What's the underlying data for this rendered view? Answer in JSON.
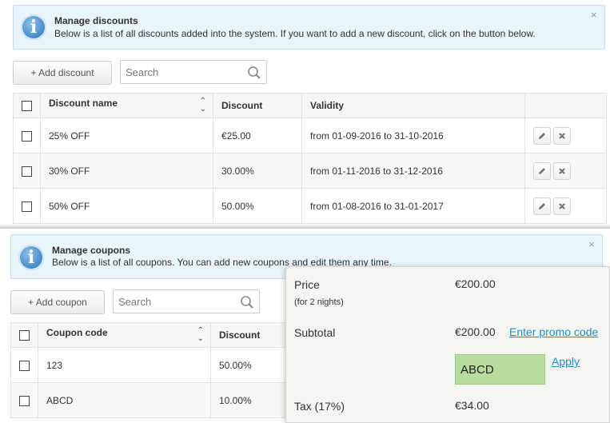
{
  "discounts_panel": {
    "info": {
      "title": "Manage discounts",
      "text": "Below is a list of all discounts added into the system. If you want to add a new discount, click on the button below.",
      "close": "×"
    },
    "add_button": "+ Add discount",
    "search_placeholder": "Search",
    "columns": [
      "Discount name",
      "Discount",
      "Validity"
    ],
    "rows": [
      {
        "name": "25% OFF",
        "discount": "€25.00",
        "validity": "from 01-09-2016 to 31-10-2016"
      },
      {
        "name": "30% OFF",
        "discount": "30.00%",
        "validity": "from 01-11-2016 to 31-12-2016"
      },
      {
        "name": "50% OFF",
        "discount": "50.00%",
        "validity": "from 01-08-2016 to 31-01-2017"
      }
    ],
    "row_actions": [
      "pencil-icon",
      "close-icon"
    ]
  },
  "coupons_panel": {
    "info": {
      "title": "Manage coupons",
      "text": "Below is a list of all coupons. You can add new coupons and edit them any time.",
      "close": "×"
    },
    "add_button": "+ Add coupon",
    "search_placeholder": "Search",
    "columns": [
      "Coupon code",
      "Discount"
    ],
    "rows": [
      {
        "code": "123",
        "discount": "50.00%"
      },
      {
        "code": "ABCD",
        "discount": "10.00%"
      }
    ]
  },
  "price_summary": {
    "price_label": "Price",
    "price_value": "€200.00",
    "nights_note": "(for 2 nights)",
    "subtotal_label": "Subtotal",
    "subtotal_value": "€200.00",
    "promo_link": "Enter promo code",
    "promo_value": "ABCD",
    "apply_link": "Apply",
    "tax_label": "Tax (17%)",
    "tax_value": "€34.00"
  },
  "colors": {
    "info_bg": "#e9f4fb",
    "link": "#1e8fc6",
    "promo_input_bg": "#b6dc9e"
  }
}
